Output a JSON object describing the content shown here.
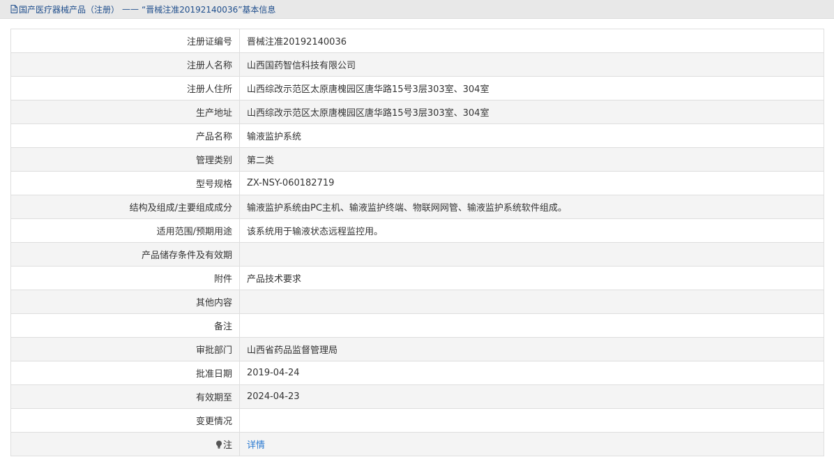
{
  "breadcrumb": {
    "icon": "document-icon",
    "root": "国产医疗器械产品（注册）",
    "separator": "——",
    "current": "“晋械注准20192140036”基本信息"
  },
  "rows": [
    {
      "label": "注册证编号",
      "value": "晋械注准20192140036"
    },
    {
      "label": "注册人名称",
      "value": "山西国药智信科技有限公司"
    },
    {
      "label": "注册人住所",
      "value": "山西综改示范区太原唐槐园区唐华路15号3层303室、304室"
    },
    {
      "label": "生产地址",
      "value": "山西综改示范区太原唐槐园区唐华路15号3层303室、304室"
    },
    {
      "label": "产品名称",
      "value": "输液监护系统"
    },
    {
      "label": "管理类别",
      "value": "第二类"
    },
    {
      "label": "型号规格",
      "value": "ZX-NSY-060182719"
    },
    {
      "label": "结构及组成/主要组成成分",
      "value": "输液监护系统由PC主机、输液监护终端、物联网网管、输液监护系统软件组成。"
    },
    {
      "label": "适用范围/预期用途",
      "value": "该系统用于输液状态远程监控用。"
    },
    {
      "label": "产品储存条件及有效期",
      "value": ""
    },
    {
      "label": "附件",
      "value": "产品技术要求"
    },
    {
      "label": "其他内容",
      "value": ""
    },
    {
      "label": "备注",
      "value": ""
    },
    {
      "label": "审批部门",
      "value": "山西省药品监督管理局"
    },
    {
      "label": "批准日期",
      "value": "2019-04-24"
    },
    {
      "label": "有效期至",
      "value": "2024-04-23"
    },
    {
      "label": "变更情况",
      "value": ""
    }
  ],
  "note_row": {
    "icon": "lightbulb-icon",
    "label": "注",
    "link_text": "详情"
  },
  "colors": {
    "link": "#2b7ad1",
    "breadcrumb": "#1f4e8c",
    "topbar_bg": "#e8e8e8",
    "row_alt_bg": "#f4f4f4",
    "border": "#dedede"
  }
}
